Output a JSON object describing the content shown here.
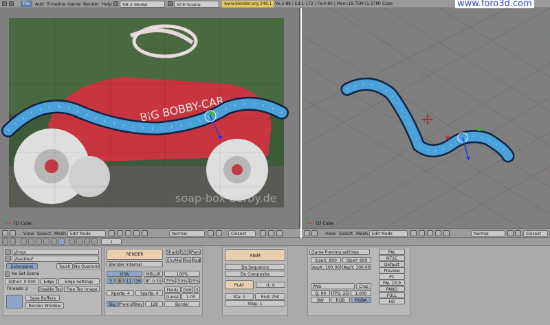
{
  "topbar": {
    "menus": [
      "File",
      "Add",
      "Timeline",
      "Game",
      "Render",
      "Help"
    ],
    "screen_field": "SR:2-Model",
    "scene_field": "SCE:Scene",
    "url": "www.blender.org 248.1",
    "stats": "Ve:2-88 | Ed:1-172 | Fa:0-86 | Mem:19.75M (1.37M) Cube",
    "brand": "www.foro3d.com"
  },
  "viewport_left": {
    "object_label": "(1) Cube",
    "watermark": "soap-box-derby.de",
    "toy_text": "BIG BOBBY-CAR"
  },
  "viewport_right": {
    "object_label": "(1) Cube"
  },
  "header_3d_left": {
    "menus": [
      "View",
      "Select",
      "Mesh"
    ],
    "mode": "Edit Mode",
    "shading": "Normal",
    "snap": "Closest"
  },
  "header_3d_right": {
    "menus": [
      "View",
      "Select",
      "Mesh"
    ],
    "mode": "Edit Mode",
    "shading": "Normal",
    "snap": "Closest"
  },
  "buttons_header": {
    "frame": "1"
  },
  "output_panel": {
    "path1": "//tmp\\",
    "path2": "//backbuf",
    "extensions": "Extensions",
    "touch": "Touch",
    "no_overwrite": "No Overwrite",
    "no_set_scene": "No Set Scene",
    "dither": "Dither: 0.000",
    "edge": "Edge",
    "edge_settings": "Edge Settings",
    "threads": "Threads: 2",
    "disable_tex": "Disable Tex",
    "free_tex_image": "Free Tex Image",
    "save_buffers": "Save Buffers",
    "render_window": "Render Window"
  },
  "render_panel": {
    "render": "RENDER",
    "engine": "Blender Internal",
    "shado": "Shado",
    "sss": "SSS",
    "pano": "Pano",
    "envma": "EnvMa",
    "ray": "Ray",
    "radi": "Radi",
    "osa": "OSA",
    "mblur": "MBLUR",
    "pct100": "100%",
    "osa_levels": [
      "5",
      "8",
      "11",
      "16"
    ],
    "bf": "Bf: 0.50",
    "pct_levels": [
      "75%",
      "50%",
      "25%"
    ],
    "fields": "Fields",
    "odd": "Odd",
    "x": "X",
    "xparts": "Xparts: 4",
    "yparts": "Yparts: 4",
    "gauss": "Gauss",
    "gauss_val": "1.00",
    "sky": "Sky",
    "premul": "Premul",
    "key": "Key",
    "key_val": "128",
    "border": "Border"
  },
  "anim_panel": {
    "anim": "ANIM",
    "do_sequence": "Do Sequence",
    "do_composite": "Do Composite",
    "play": "PLAY",
    "rt": "rt: 0",
    "sta": "Sta: 1",
    "end": "End: 250",
    "step": "Step: 1"
  },
  "format_panel": {
    "preset": "Game framing settings",
    "sizex": "SizeX: 800",
    "sizey": "SizeY: 600",
    "aspx": "AspX: 100.00",
    "aspy": "AspY: 100.00",
    "format": "PNG",
    "crop": "Crop",
    "quality": "Q: 90",
    "fps": "FPS: 25",
    "fps_base": "1.000",
    "bw": "BW",
    "rgb": "RGB",
    "rgba": "RGBA",
    "presets": [
      "PAL",
      "NTSC",
      "Default",
      "Preview",
      "PC",
      "PAL 16:9",
      "PANO",
      "FULL",
      "HD"
    ]
  },
  "colors": {
    "accent_blue": "#8da3c7",
    "tan": "#e8cfb0",
    "url_bg": "#e4c75c",
    "brand": "#2a46c9"
  }
}
